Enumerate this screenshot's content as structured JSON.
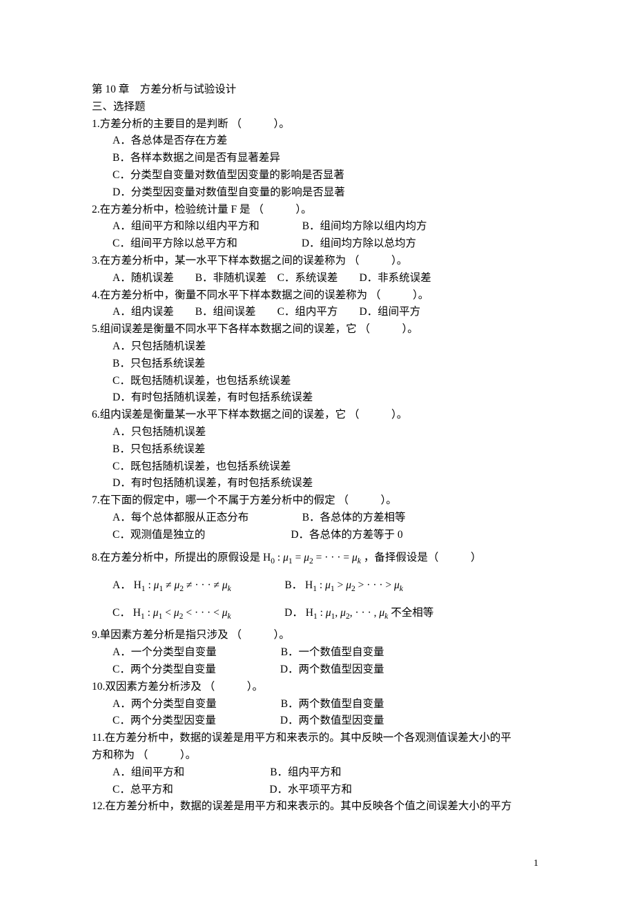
{
  "chapter": "第 10 章　方差分析与试验设计",
  "section": "三、选择题",
  "pageNumber": "1",
  "q1": {
    "stem": "1.方差分析的主要目的是判断 （　　　）。",
    "A": "A．各总体是否存在方差",
    "B": "B．各样本数据之间是否有显著差异",
    "C": "C．分类型自变量对数值型因变量的影响是否显著",
    "D": "D．分类型因变量对数值型自变量的影响是否显著"
  },
  "q2": {
    "stem": "2.在方差分析中，检验统计量 F 是 （　　　）。",
    "A": "A．组间平方和除以组内平方和",
    "B": "B．组间均方除以组内均方",
    "C": "C．组间平方除以总平方和",
    "D": "D．组间均方除以总均方"
  },
  "q3": {
    "stem": "3.在方差分析中，某一水平下样本数据之间的误差称为 （　　　）。",
    "A": "A．随机误差",
    "B": "B．非随机误差",
    "C": "C．系统误差",
    "D": "D．非系统误差"
  },
  "q4": {
    "stem": "4.在方差分析中，衡量不同水平下样本数据之间的误差称为 （　　　）。",
    "A": "A．组内误差",
    "B": "B．组间误差",
    "C": "C．组内平方",
    "D": "D．组间平方"
  },
  "q5": {
    "stem": "5.组间误差是衡量不同水平下各样本数据之间的误差，它 （　　　）。",
    "A": "A．只包括随机误差",
    "B": "B．只包括系统误差",
    "C": "C．既包括随机误差，也包括系统误差",
    "D": "D．有时包括随机误差，有时包括系统误差"
  },
  "q6": {
    "stem": "6.组内误差是衡量某一水平下样本数据之间的误差，它 （　　　）。",
    "A": "A．只包括随机误差",
    "B": "B．只包括系统误差",
    "C": "C．既包括随机误差，也包括系统误差",
    "D": "D．有时包括随机误差，有时包括系统误差"
  },
  "q7": {
    "stem": "7.在下面的假定中，哪一个不属于方差分析中的假定 （　　　）。",
    "A": "A．每个总体都服从正态分布",
    "B": "B．各总体的方差相等",
    "C": "C．观测值是独立的",
    "D": "D．各总体的方差等于 0"
  },
  "q8": {
    "stemPrefix": "8.在方差分析中，所提出的原假设是",
    "stemSuffix": "，备择假设是（　　　）",
    "h0": "H",
    "mu": "μ",
    "A": "A．",
    "B": "B．",
    "C": "C．",
    "D": "D．",
    "dTail": " 不全相等"
  },
  "q9": {
    "stem": "9.单因素方差分析是指只涉及 （　　　）。",
    "A": "A．一个分类型自变量",
    "B": "B．一个数值型自变量",
    "C": "C．两个分类型自变量",
    "D": "D．两个数值型因变量"
  },
  "q10": {
    "stem": "10.双因素方差分析涉及 （　　　）。",
    "A": "A．两个分类型自变量",
    "B": "B．两个数值型自变量",
    "C": "C．两个分类型因变量",
    "D": "D．两个数值型因变量"
  },
  "q11": {
    "stem1": "11.在方差分析中，数据的误差是用平方和来表示的。其中反映一个各观测值误差大小的平",
    "stem2": "方和称为 （　　　）。",
    "A": "A．组间平方和",
    "B": "B．组内平方和",
    "C": "C．总平方和",
    "D": "D．水平项平方和"
  },
  "q12": {
    "stem": "12.在方差分析中，数据的误差是用平方和来表示的。其中反映各个值之间误差大小的平方"
  }
}
